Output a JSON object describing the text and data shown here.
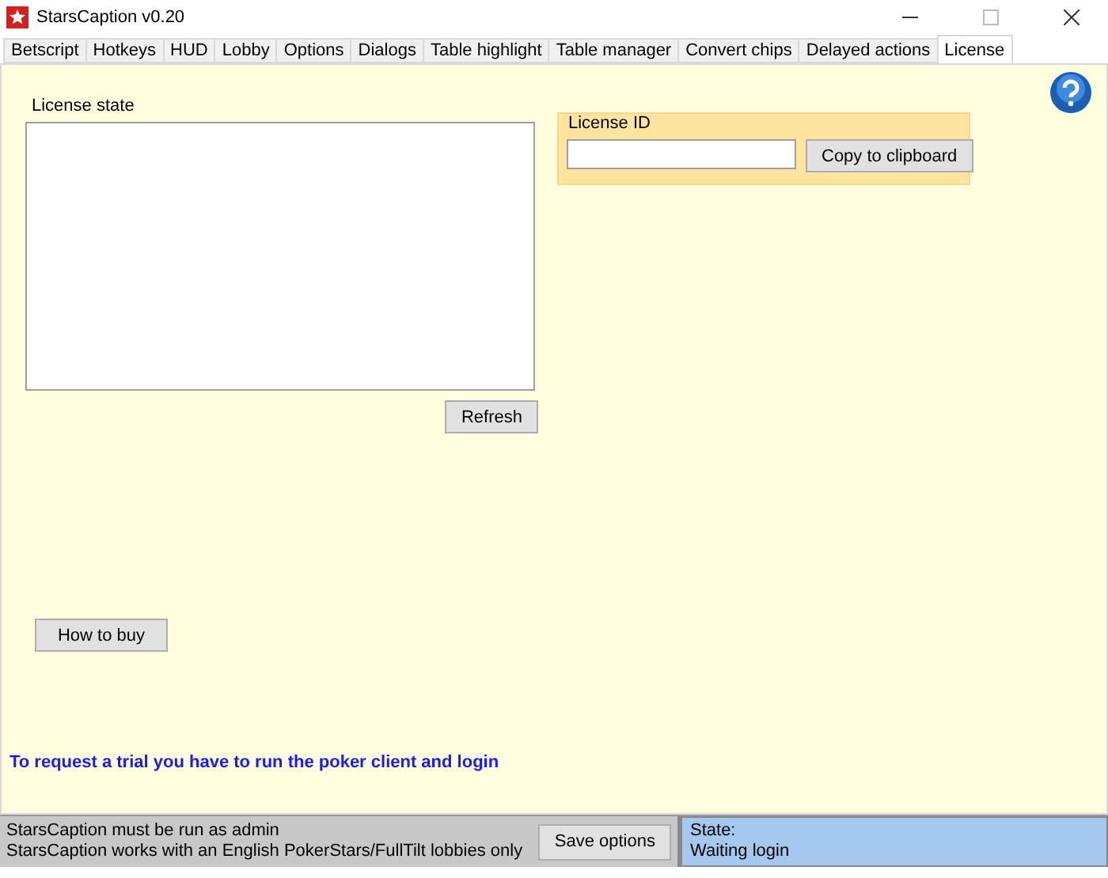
{
  "window": {
    "title": "StarsCaption v0.20"
  },
  "tabs": [
    {
      "label": "Betscript",
      "selected": false
    },
    {
      "label": "Hotkeys",
      "selected": false
    },
    {
      "label": "HUD",
      "selected": false
    },
    {
      "label": "Lobby",
      "selected": false
    },
    {
      "label": "Options",
      "selected": false
    },
    {
      "label": "Dialogs",
      "selected": false
    },
    {
      "label": "Table highlight",
      "selected": false
    },
    {
      "label": "Table manager",
      "selected": false
    },
    {
      "label": "Convert chips",
      "selected": false
    },
    {
      "label": "Delayed actions",
      "selected": false
    },
    {
      "label": "License",
      "selected": true
    }
  ],
  "license_state": {
    "label": "License state",
    "refresh_button": "Refresh"
  },
  "license_id": {
    "label": "License ID",
    "copy_button": "Copy to clipboard"
  },
  "how_to_buy_button": "How to buy",
  "trial_note": "To request a trial you have to run the poker client and login",
  "status_bar": {
    "messages": [
      "StarsCaption must be run as admin",
      "StarsCaption works with an English PokerStars/FullTilt lobbies only"
    ],
    "save_button": "Save options",
    "state_label": "State:",
    "state_value": "Waiting login"
  }
}
